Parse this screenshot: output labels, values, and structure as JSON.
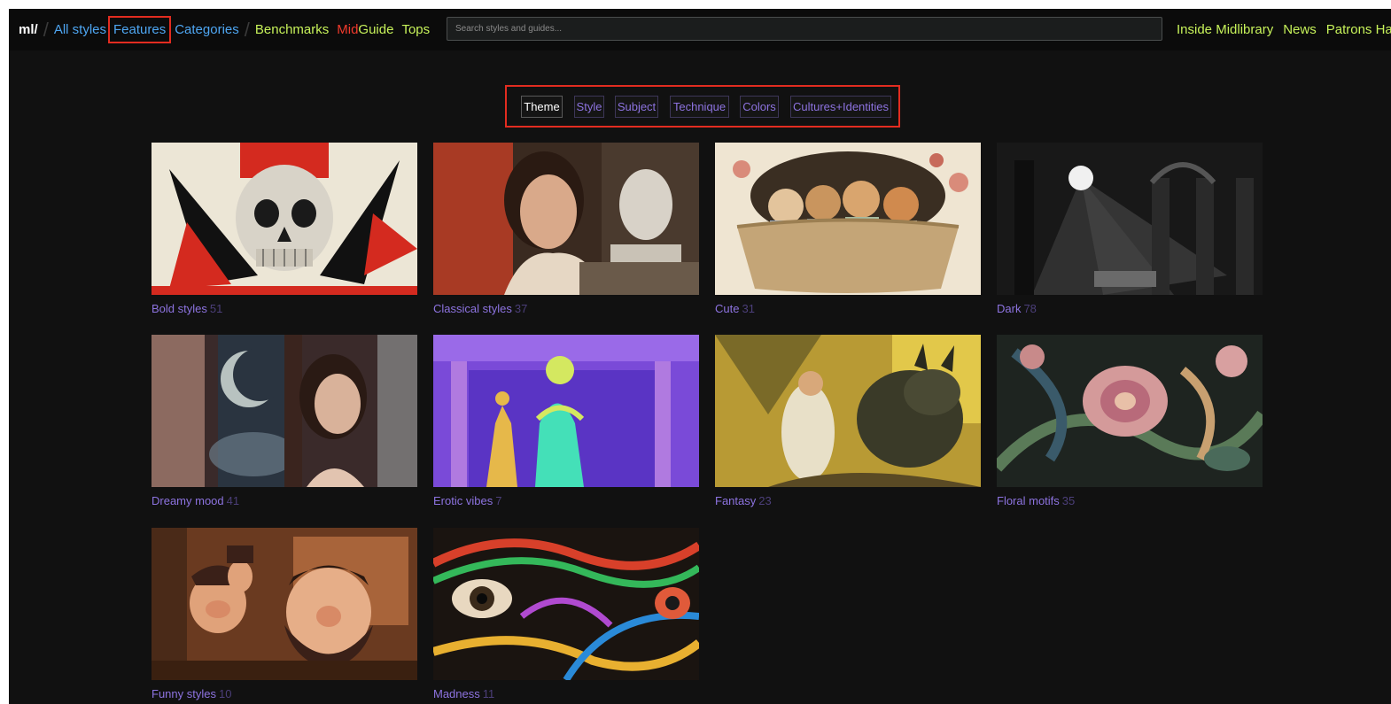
{
  "nav": {
    "logo": "ml/",
    "all_styles": "All styles",
    "features": "Features",
    "categories": "Categories",
    "benchmarks": "Benchmarks",
    "midguide_mid": "Mid",
    "midguide_guide": "Guide",
    "tops": "Tops",
    "search_placeholder": "Search styles and guides...",
    "right": [
      "Inside Midlibrary",
      "News",
      "Patrons Ha"
    ]
  },
  "filters": [
    {
      "label": "Theme",
      "active": true
    },
    {
      "label": "Style",
      "active": false
    },
    {
      "label": "Subject",
      "active": false
    },
    {
      "label": "Technique",
      "active": false
    },
    {
      "label": "Colors",
      "active": false
    },
    {
      "label": "Cultures+Identities",
      "active": false
    }
  ],
  "cards": [
    {
      "name": "Bold styles",
      "count": "51"
    },
    {
      "name": "Classical styles",
      "count": "37"
    },
    {
      "name": "Cute",
      "count": "31"
    },
    {
      "name": "Dark",
      "count": "78"
    },
    {
      "name": "Dreamy mood",
      "count": "41"
    },
    {
      "name": "Erotic vibes",
      "count": "7"
    },
    {
      "name": "Fantasy",
      "count": "23"
    },
    {
      "name": "Floral motifs",
      "count": "35"
    },
    {
      "name": "Funny styles",
      "count": "10"
    },
    {
      "name": "Madness",
      "count": "11"
    }
  ],
  "colors": {
    "background": "#111111",
    "nav_blue": "#4ea6f2",
    "nav_green": "#c7f25a",
    "accent_purple": "#8d73e0",
    "highlight_red": "#e22c20"
  }
}
